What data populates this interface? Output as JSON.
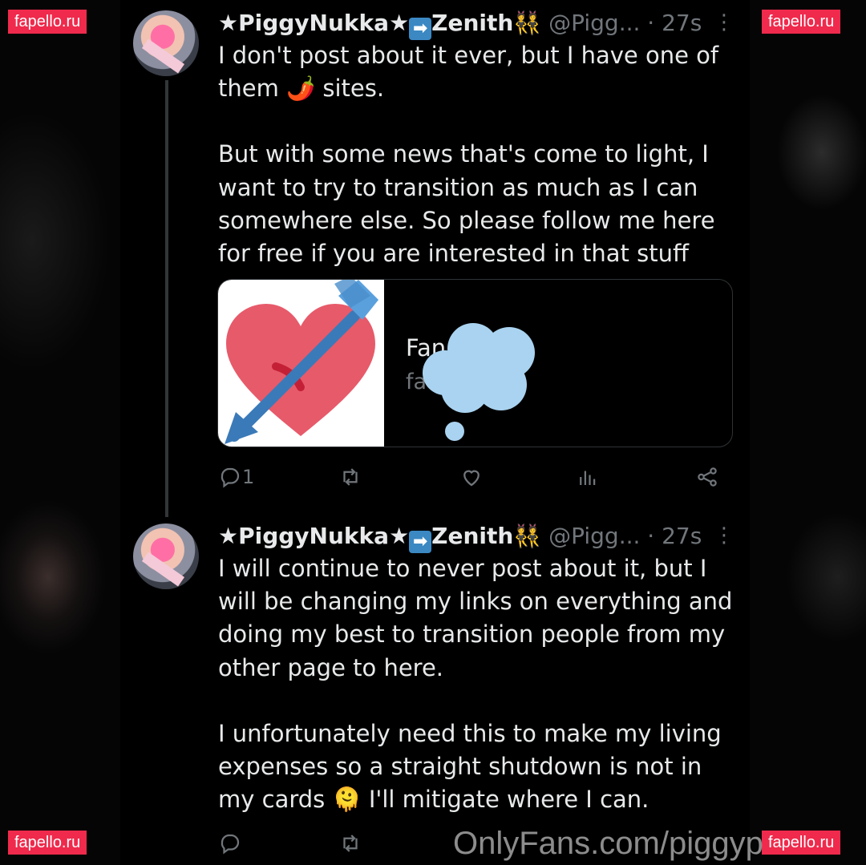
{
  "watermarks": {
    "top_left": "fapello.ru",
    "top_right": "fapello.ru",
    "bottom_left": "fapello.ru",
    "bottom_right": "fapello.ru",
    "bottom_center": "OnlyFans.com/piggyp"
  },
  "tweets": [
    {
      "display_name": "★PiggyNukka★➡️Zenith👯",
      "name_main": "★PiggyNukka★",
      "name_arrow": "➡",
      "name_tail": "Zenith👯",
      "handle": "@Pigg...",
      "time": "· 27s",
      "more_icon": "more-dots-icon",
      "body": [
        "I don't post about it ever, but I have one of them 🌶️ sites.",
        "But with some news that's come to light, I want to try to transition as much as I can somewhere else. So please follow me here for free if you are interested in that stuff"
      ],
      "link_card": {
        "title": "Fan",
        "domain": "fa",
        "thumbnail_icon": "heart-with-arrow-icon",
        "overlay_icon": "thought-cloud-icon"
      },
      "actions": {
        "reply_count": "1",
        "retweet_count": "",
        "like_count": "",
        "views_count": ""
      }
    },
    {
      "display_name": "★PiggyNukka★➡️Zenith👯",
      "name_main": "★PiggyNukka★",
      "name_arrow": "➡",
      "name_tail": "Zenith👯",
      "handle": "@Pigg...",
      "time": "· 27s",
      "more_icon": "more-dots-icon",
      "body": [
        "I will continue to never post about it, but I will be changing my links on everything and doing my best to transition people from my other page to here.",
        "I unfortunately need this to make my living expenses so a straight shutdown is not in my cards 🫠 I'll mitigate where I can."
      ],
      "actions": {
        "reply_count": "",
        "retweet_count": ""
      }
    }
  ],
  "colors": {
    "background": "#000000",
    "text": "#e7e9ea",
    "muted": "#71767b",
    "border": "#2f3336",
    "watermark": "#ef2a4c",
    "heart": "#dd2e44",
    "arrow": "#3b88c3"
  }
}
